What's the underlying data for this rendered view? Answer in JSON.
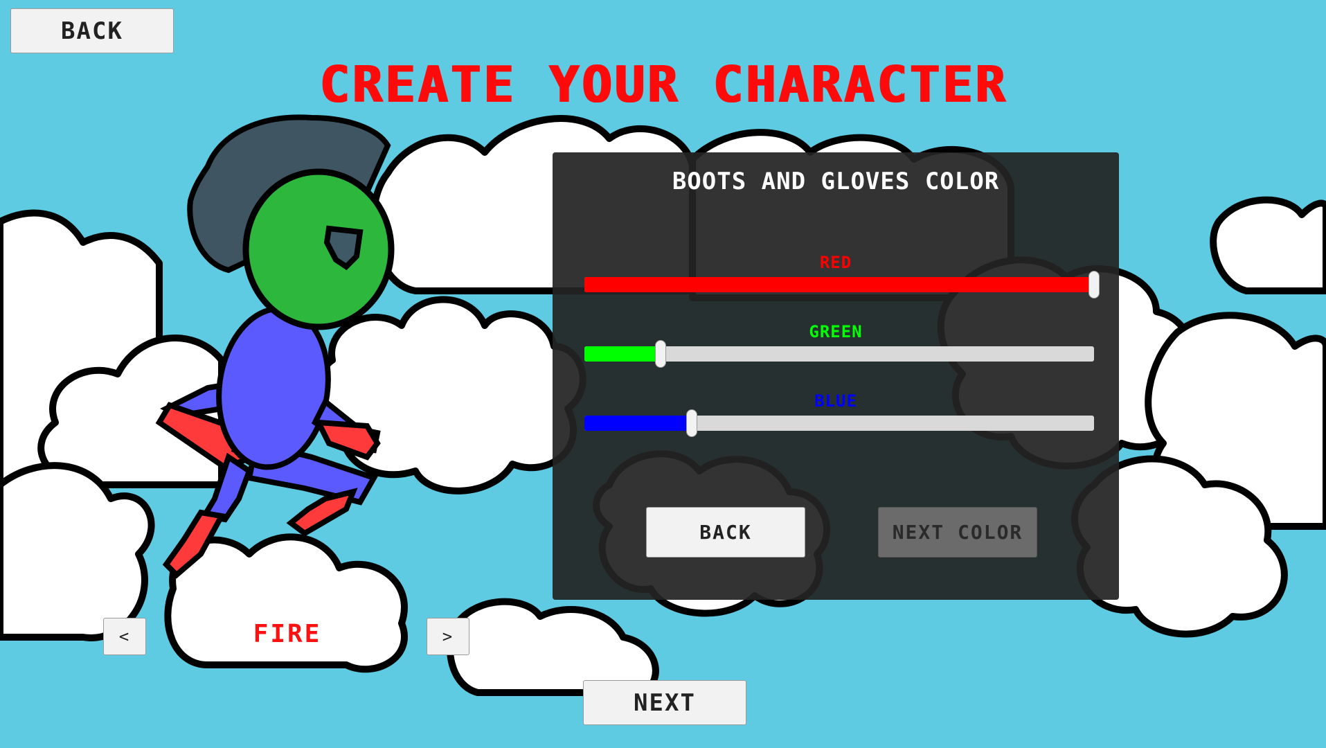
{
  "screen": {
    "title": "CREATE YOUR CHARACTER",
    "back_label": "BACK",
    "next_label": "NEXT",
    "background_color": "#5ecbe3"
  },
  "color_panel": {
    "title": "BOOTS AND GLOVES COLOR",
    "back_label": "BACK",
    "next_color_label": "NEXT COLOR",
    "sliders": [
      {
        "label": "RED",
        "value": 1.0,
        "color": "#ff0000"
      },
      {
        "label": "GREEN",
        "value": 0.15,
        "color": "#00ff00"
      },
      {
        "label": "BLUE",
        "value": 0.21,
        "color": "#0000ff"
      }
    ]
  },
  "character_selector": {
    "prev_label": "<",
    "next_label": ">",
    "name": "FIRE",
    "name_color": "#ff1010"
  },
  "character": {
    "hair_color": "#3f5562",
    "head_color": "#2db83d",
    "body_color": "#5a5aff",
    "boots_gloves_color": "#ff3a3a"
  }
}
